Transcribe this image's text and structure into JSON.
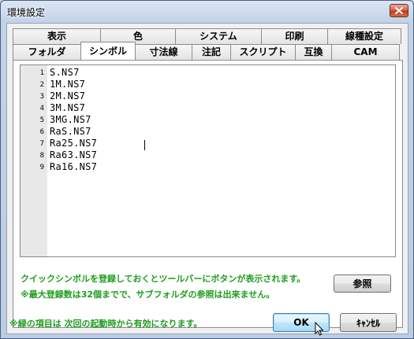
{
  "window": {
    "title": "環境設定"
  },
  "tabs": {
    "row1": [
      {
        "label": "表示"
      },
      {
        "label": "色"
      },
      {
        "label": "システム"
      },
      {
        "label": "印刷"
      },
      {
        "label": "線種設定"
      }
    ],
    "row2": [
      {
        "label": "フォルダ"
      },
      {
        "label": "シンボル"
      },
      {
        "label": "寸法線"
      },
      {
        "label": "注記"
      },
      {
        "label": "スクリプト"
      },
      {
        "label": "互換"
      },
      {
        "label": "CAM"
      }
    ],
    "active": "シンボル"
  },
  "editor": {
    "lines": [
      {
        "num": "1",
        "text": "S.NS7"
      },
      {
        "num": "2",
        "text": "1M.NS7"
      },
      {
        "num": "3",
        "text": "2M.NS7"
      },
      {
        "num": "4",
        "text": "3M.NS7"
      },
      {
        "num": "5",
        "text": "3MG.NS7"
      },
      {
        "num": "6",
        "text": "RaS.NS7"
      },
      {
        "num": "7",
        "text": "Ra25.NS7"
      },
      {
        "num": "8",
        "text": "Ra63.NS7"
      },
      {
        "num": "9",
        "text": "Ra16.NS7"
      }
    ]
  },
  "panel": {
    "info1": "クイックシンボルを登録しておくとツールバーにボタンが表示されます。",
    "info2": "※最大登録数は32個までで、サブフォルダの参照は出来ません。",
    "browse_label": "参照"
  },
  "footer": {
    "note": "※緑の項目は 次回の起動時から有効になります。",
    "ok_label": "OK",
    "cancel_label": "ｷｬﾝｾﾙ"
  },
  "colors": {
    "accent_green": "#1f9c1f",
    "close_red": "#c0391e"
  }
}
